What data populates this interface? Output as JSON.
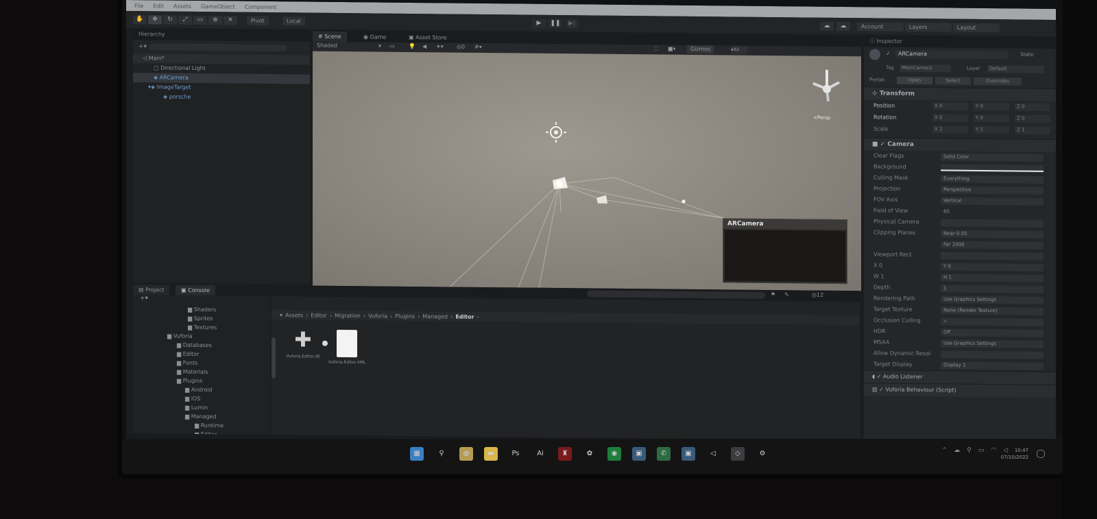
{
  "menubar": {
    "items": [
      "File",
      "Edit",
      "Assets",
      "GameObject",
      "Component"
    ]
  },
  "toolbar": {
    "pivot": "Pivot",
    "local": "Local",
    "play_icon": "play-icon",
    "pause_icon": "pause-icon",
    "step_icon": "step-icon",
    "account": "Account",
    "layers": "Layers",
    "layout": "Layout"
  },
  "hierarchy": {
    "tab": "Hierarchy",
    "scene": "Main*",
    "items": [
      "Directional Light",
      "ARCamera",
      "ImageTarget",
      "porsche"
    ]
  },
  "scene_view": {
    "tabs": [
      "Scene",
      "Game",
      "Asset Store"
    ],
    "shading_mode": "Shaded",
    "gizmos": "Gizmos",
    "persp_label": "<Persp",
    "camera_preview_title": "ARCamera"
  },
  "inspector": {
    "tab": "Inspector",
    "object_name": "ARCamera",
    "static": "Static",
    "tag_label": "Tag",
    "tag_value": "MainCamera",
    "layer_label": "Layer",
    "layer_value": "Default",
    "prefab_label": "Prefab",
    "prefab_open": "Open",
    "prefab_select": "Select",
    "prefab_overrides": "Overrides",
    "transform": {
      "title": "Transform",
      "rows": [
        {
          "label": "Position",
          "x": "X 0",
          "y": "Y 0",
          "z": "Z 0"
        },
        {
          "label": "Rotation",
          "x": "X 0",
          "y": "Y 0",
          "z": "Z 0"
        },
        {
          "label": "Scale",
          "x": "X 1",
          "y": "Y 1",
          "z": "Z 1"
        }
      ]
    },
    "camera": {
      "title": "Camera",
      "rows": [
        {
          "label": "Clear Flags",
          "value": "Solid Color"
        },
        {
          "label": "Background",
          "value": ""
        },
        {
          "label": "Culling Mask",
          "value": "Everything"
        },
        {
          "label": "Projection",
          "value": "Perspective"
        },
        {
          "label": "FOV Axis",
          "value": "Vertical"
        },
        {
          "label": "Field of View",
          "value": "60"
        },
        {
          "label": "Physical Camera",
          "value": ""
        },
        {
          "label": "Clipping Planes",
          "value": "Near 0.05"
        },
        {
          "label": "",
          "value": "Far 2000"
        },
        {
          "label": "Viewport Rect",
          "value": ""
        },
        {
          "label": "X 0",
          "value": "Y 0"
        },
        {
          "label": "W 1",
          "value": "H 1"
        },
        {
          "label": "Depth",
          "value": "1"
        },
        {
          "label": "Rendering Path",
          "value": "Use Graphics Settings"
        },
        {
          "label": "Target Texture",
          "value": "None (Render Texture)"
        },
        {
          "label": "Occlusion Culling",
          "value": "✓"
        },
        {
          "label": "HDR",
          "value": "Off"
        },
        {
          "label": "MSAA",
          "value": "Use Graphics Settings"
        },
        {
          "label": "Allow Dynamic Resol",
          "value": ""
        },
        {
          "label": "Target Display",
          "value": "Display 1"
        }
      ]
    },
    "audio_listener": "Audio Listener",
    "vuforia_behaviour": "Vuforia Behaviour (Script)"
  },
  "project": {
    "tabs": [
      "Project",
      "Console"
    ],
    "tree": [
      "Shaders",
      "Sprites",
      "Textures",
      "Vuforia",
      "Databases",
      "Editor",
      "Fonts",
      "Materials",
      "Plugins",
      "Android",
      "iOS",
      "Lumin",
      "Managed",
      "Runtime",
      "Editor"
    ],
    "breadcrumb": [
      "Assets",
      "Editor",
      "Migration",
      "Vuforia",
      "Plugins",
      "Managed",
      "Editor"
    ],
    "assets": [
      {
        "name": "Vuforia.Editor.dll",
        "icon": "plugin-icon"
      },
      {
        "name": "Vuforia.Editor.XML",
        "icon": "document-icon"
      }
    ],
    "count": "12"
  },
  "taskbar": {
    "icons": [
      "windows-start-icon",
      "search-icon",
      "chrome-icon",
      "file-explorer-icon",
      "photoshop-icon",
      "illustrator-icon",
      "acrobat-icon",
      "paint-icon",
      "spotify-icon",
      "app-icon",
      "whatsapp-icon",
      "app-icon",
      "vscode-icon",
      "unity-icon",
      "settings-icon"
    ],
    "ps": "Ps",
    "ai": "Ai",
    "time": "10:47",
    "date": "07/10/2022"
  },
  "colors": {
    "editor_bg": "#1c1d1f",
    "scene_bg": "#8d8880",
    "accent_selection": "#34383d",
    "prefab_blue": "#6e9fd0"
  }
}
